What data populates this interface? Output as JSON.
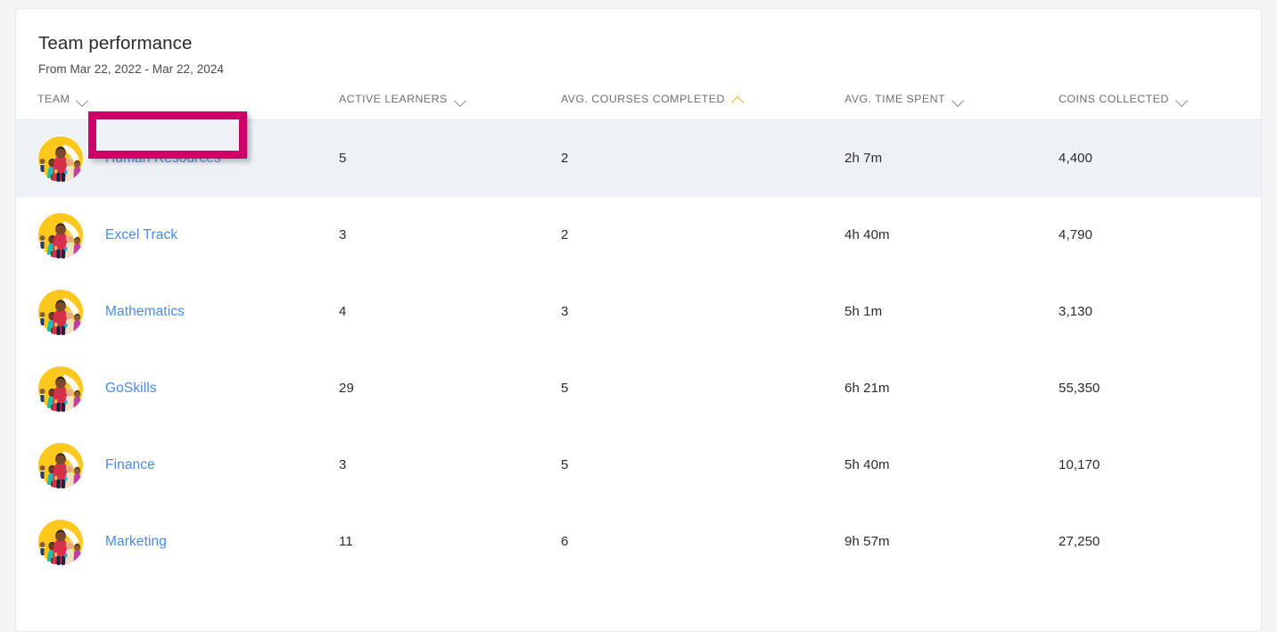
{
  "card": {
    "title": "Team performance",
    "subtitle": "From Mar 22, 2022 - Mar 22, 2024"
  },
  "colors": {
    "link": "#4a8ae8",
    "highlight_box": "#cc0066",
    "active_sort": "#f4b223",
    "row_highlight_bg": "#eef2f6",
    "header_text": "#6b7077"
  },
  "table": {
    "columns": [
      {
        "label": "TEAM",
        "sort_icon": "chevron-down-icon",
        "sort_active": false
      },
      {
        "label": "ACTIVE LEARNERS",
        "sort_icon": "chevron-down-icon",
        "sort_active": false
      },
      {
        "label": "AVG. COURSES COMPLETED",
        "sort_icon": "chevron-up-icon",
        "sort_active": true
      },
      {
        "label": "AVG. TIME SPENT",
        "sort_icon": "chevron-down-icon",
        "sort_active": false
      },
      {
        "label": "COINS COLLECTED",
        "sort_icon": "chevron-down-icon",
        "sort_active": false
      }
    ],
    "rows": [
      {
        "team": "Human Resources",
        "active_learners": "5",
        "avg_courses_completed": "2",
        "avg_time_spent": "2h 7m",
        "coins_collected": "4,400",
        "row_highlighted": true,
        "annotation_box": true
      },
      {
        "team": "Excel Track",
        "active_learners": "3",
        "avg_courses_completed": "2",
        "avg_time_spent": "4h 40m",
        "coins_collected": "4,790",
        "row_highlighted": false,
        "annotation_box": false
      },
      {
        "team": "Mathematics",
        "active_learners": "4",
        "avg_courses_completed": "3",
        "avg_time_spent": "5h 1m",
        "coins_collected": "3,130",
        "row_highlighted": false,
        "annotation_box": false
      },
      {
        "team": "GoSkills",
        "active_learners": "29",
        "avg_courses_completed": "5",
        "avg_time_spent": "6h 21m",
        "coins_collected": "55,350",
        "row_highlighted": false,
        "annotation_box": false
      },
      {
        "team": "Finance",
        "active_learners": "3",
        "avg_courses_completed": "5",
        "avg_time_spent": "5h 40m",
        "coins_collected": "10,170",
        "row_highlighted": false,
        "annotation_box": false
      },
      {
        "team": "Marketing",
        "active_learners": "11",
        "avg_courses_completed": "6",
        "avg_time_spent": "9h 57m",
        "coins_collected": "27,250",
        "row_highlighted": false,
        "annotation_box": false
      }
    ]
  }
}
